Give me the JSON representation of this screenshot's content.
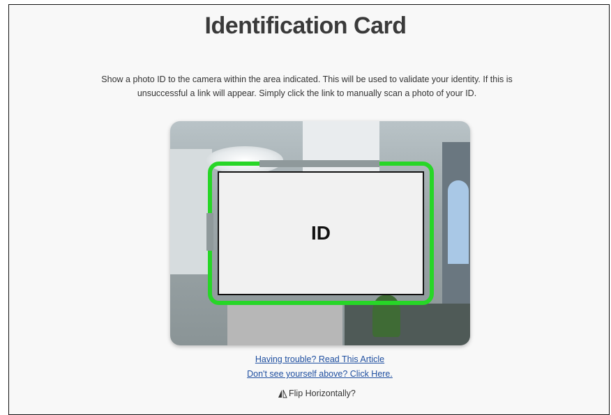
{
  "header": {
    "title": "Identification Card"
  },
  "instructions": {
    "text": "Show a photo ID to the camera within the area indicated. This will be used to validate your identity. If this is unsuccessful a link will appear. Simply click the link to manually scan a photo of your ID."
  },
  "camera": {
    "id_label": "ID",
    "frame_color": "#27d627"
  },
  "links": {
    "trouble": "Having trouble? Read This Article",
    "not_seen": "Don't see yourself above? Click Here."
  },
  "flip": {
    "icon": "flip-icon",
    "label": "Flip Horizontally?"
  }
}
